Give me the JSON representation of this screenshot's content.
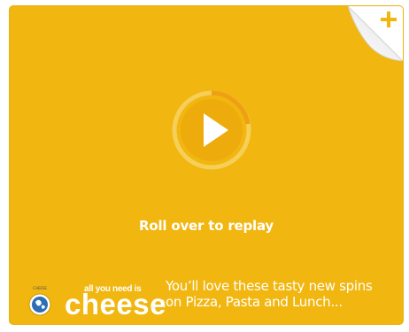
{
  "ad": {
    "accent_color": "#f1b60f",
    "play_icon": "play-icon",
    "replay_text": "Roll over to replay",
    "corner_icon": "plus-icon",
    "logo": {
      "brand_small": "all you need is",
      "brand_big": "cheese",
      "registered_mark": "®",
      "seal_icon": "globe-seal-icon"
    },
    "tagline": {
      "line1": "You’ll love these tasty new spins",
      "line2": "on Pizza, Pasta and Lunch..."
    }
  }
}
